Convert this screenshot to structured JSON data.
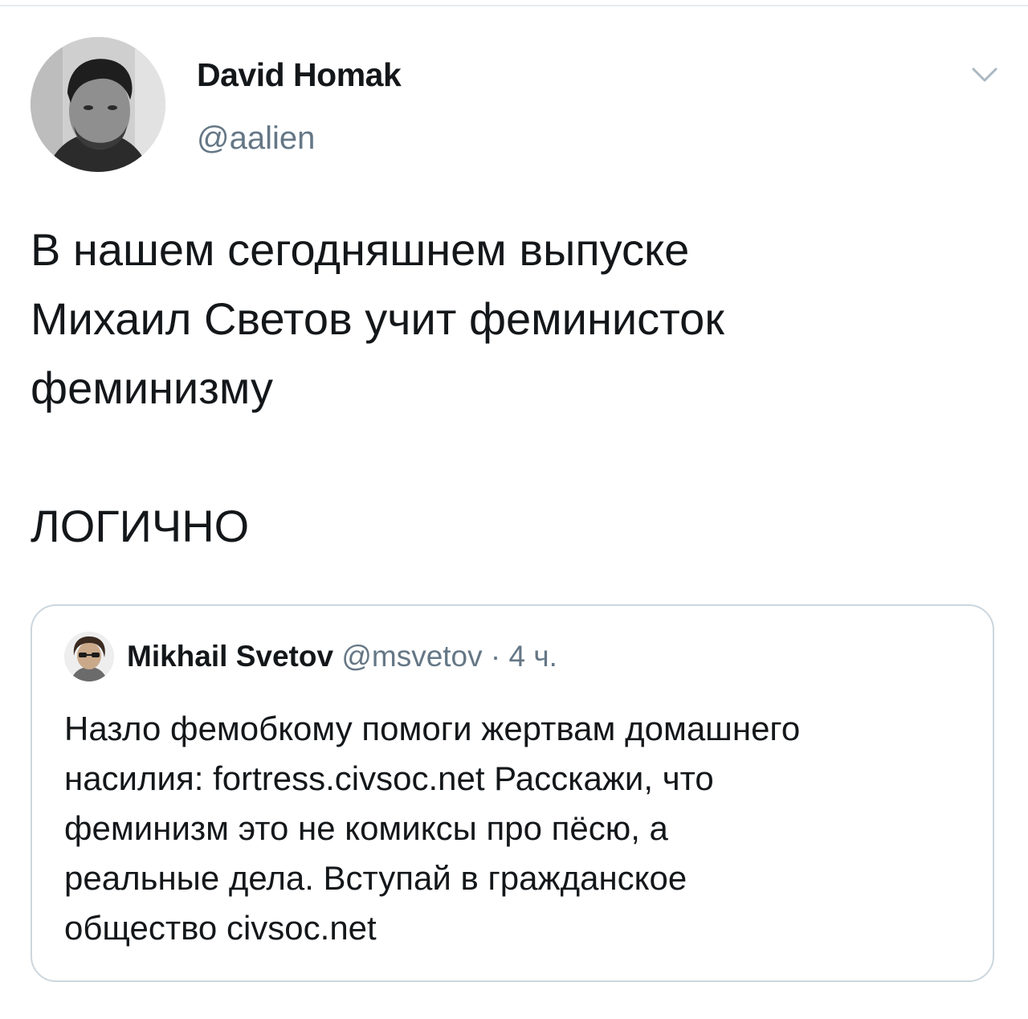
{
  "author": {
    "display_name": "David Homak",
    "handle": "@aalien",
    "avatar_icon": "user-avatar"
  },
  "tweet": {
    "lines": [
      "В нашем сегодняшнем выпуске",
      "Михаил Светов учит феминисток",
      "феминизму",
      "ЛОГИЧНО"
    ]
  },
  "quoted": {
    "display_name": "Mikhail Svetov",
    "handle": "@msvetov",
    "separator": "·",
    "time": "4 ч.",
    "avatar_icon": "user-avatar",
    "lines": [
      "Назло фемобкому помоги жертвам домашнего",
      "насилия: fortress.civsoc.net Расскажи, что",
      "феминизм это не комиксы про пёсю, а",
      "реальные дела. Вступай в гражданское",
      "общество civsoc.net"
    ]
  },
  "colors": {
    "text": "#14171a",
    "secondary": "#657786",
    "border": "#ccd6dd"
  }
}
